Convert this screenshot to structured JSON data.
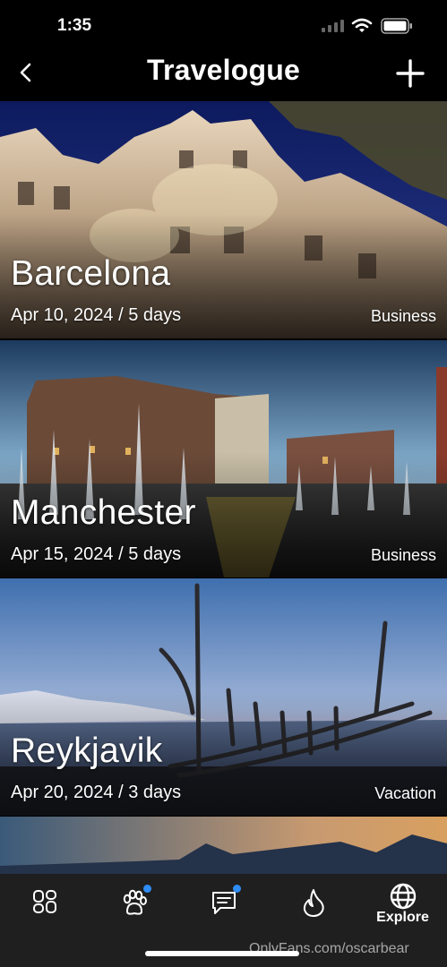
{
  "status_bar": {
    "time": "1:35"
  },
  "header": {
    "title": "Travelogue"
  },
  "trips": [
    {
      "city": "Barcelona",
      "dates": "Apr 10, 2024 / 5 days",
      "tag": "Business"
    },
    {
      "city": "Manchester",
      "dates": "Apr 15, 2024 / 5 days",
      "tag": "Business"
    },
    {
      "city": "Reykjavik",
      "dates": "Apr 20, 2024 / 3 days",
      "tag": "Vacation"
    }
  ],
  "tab_bar": {
    "tabs": [
      {
        "icon": "grid-icon",
        "badge": false
      },
      {
        "icon": "paw-icon",
        "badge": true
      },
      {
        "icon": "chat-icon",
        "badge": true
      },
      {
        "icon": "flame-icon",
        "badge": false
      },
      {
        "icon": "globe-icon",
        "label": "Explore",
        "active": true
      }
    ]
  },
  "watermark": "OnlyFans.com/oscarbear",
  "colors": {
    "background": "#000000",
    "tab_bar": "#1f1f1f",
    "badge": "#2f8df5"
  }
}
